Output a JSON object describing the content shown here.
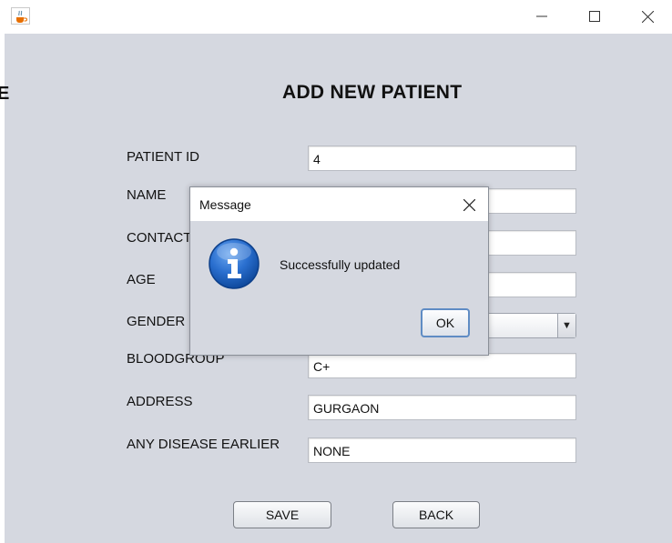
{
  "window": {
    "app_icon": "java-coffee-icon",
    "controls": {
      "minimize": "minimize-icon",
      "maximize": "maximize-icon",
      "close": "close-icon"
    }
  },
  "background": {
    "cut_text": "E"
  },
  "form": {
    "title": "ADD NEW PATIENT",
    "fields": {
      "patient_id": {
        "label": "PATIENT ID",
        "value": "4"
      },
      "name": {
        "label": "NAME",
        "value": ""
      },
      "contact": {
        "label": "CONTACT",
        "value": ""
      },
      "age": {
        "label": "AGE",
        "value": ""
      },
      "gender": {
        "label": "GENDER",
        "value": ""
      },
      "bloodgroup": {
        "label": "BLOODGROUP",
        "value": "C+"
      },
      "address": {
        "label": "ADDRESS",
        "value": "GURGAON"
      },
      "disease": {
        "label": "ANY  DISEASE EARLIER",
        "value": "NONE"
      }
    },
    "buttons": {
      "save": "SAVE",
      "back": "BACK"
    }
  },
  "dialog": {
    "title": "Message",
    "message": "Successfully updated",
    "ok_label": "OK",
    "icon": "info-icon"
  },
  "colors": {
    "panel": "#d5d8e0",
    "titlebar": "#ffffff",
    "info_blue": "#1b5fb8",
    "ok_focus_border": "#5f8cc4"
  }
}
